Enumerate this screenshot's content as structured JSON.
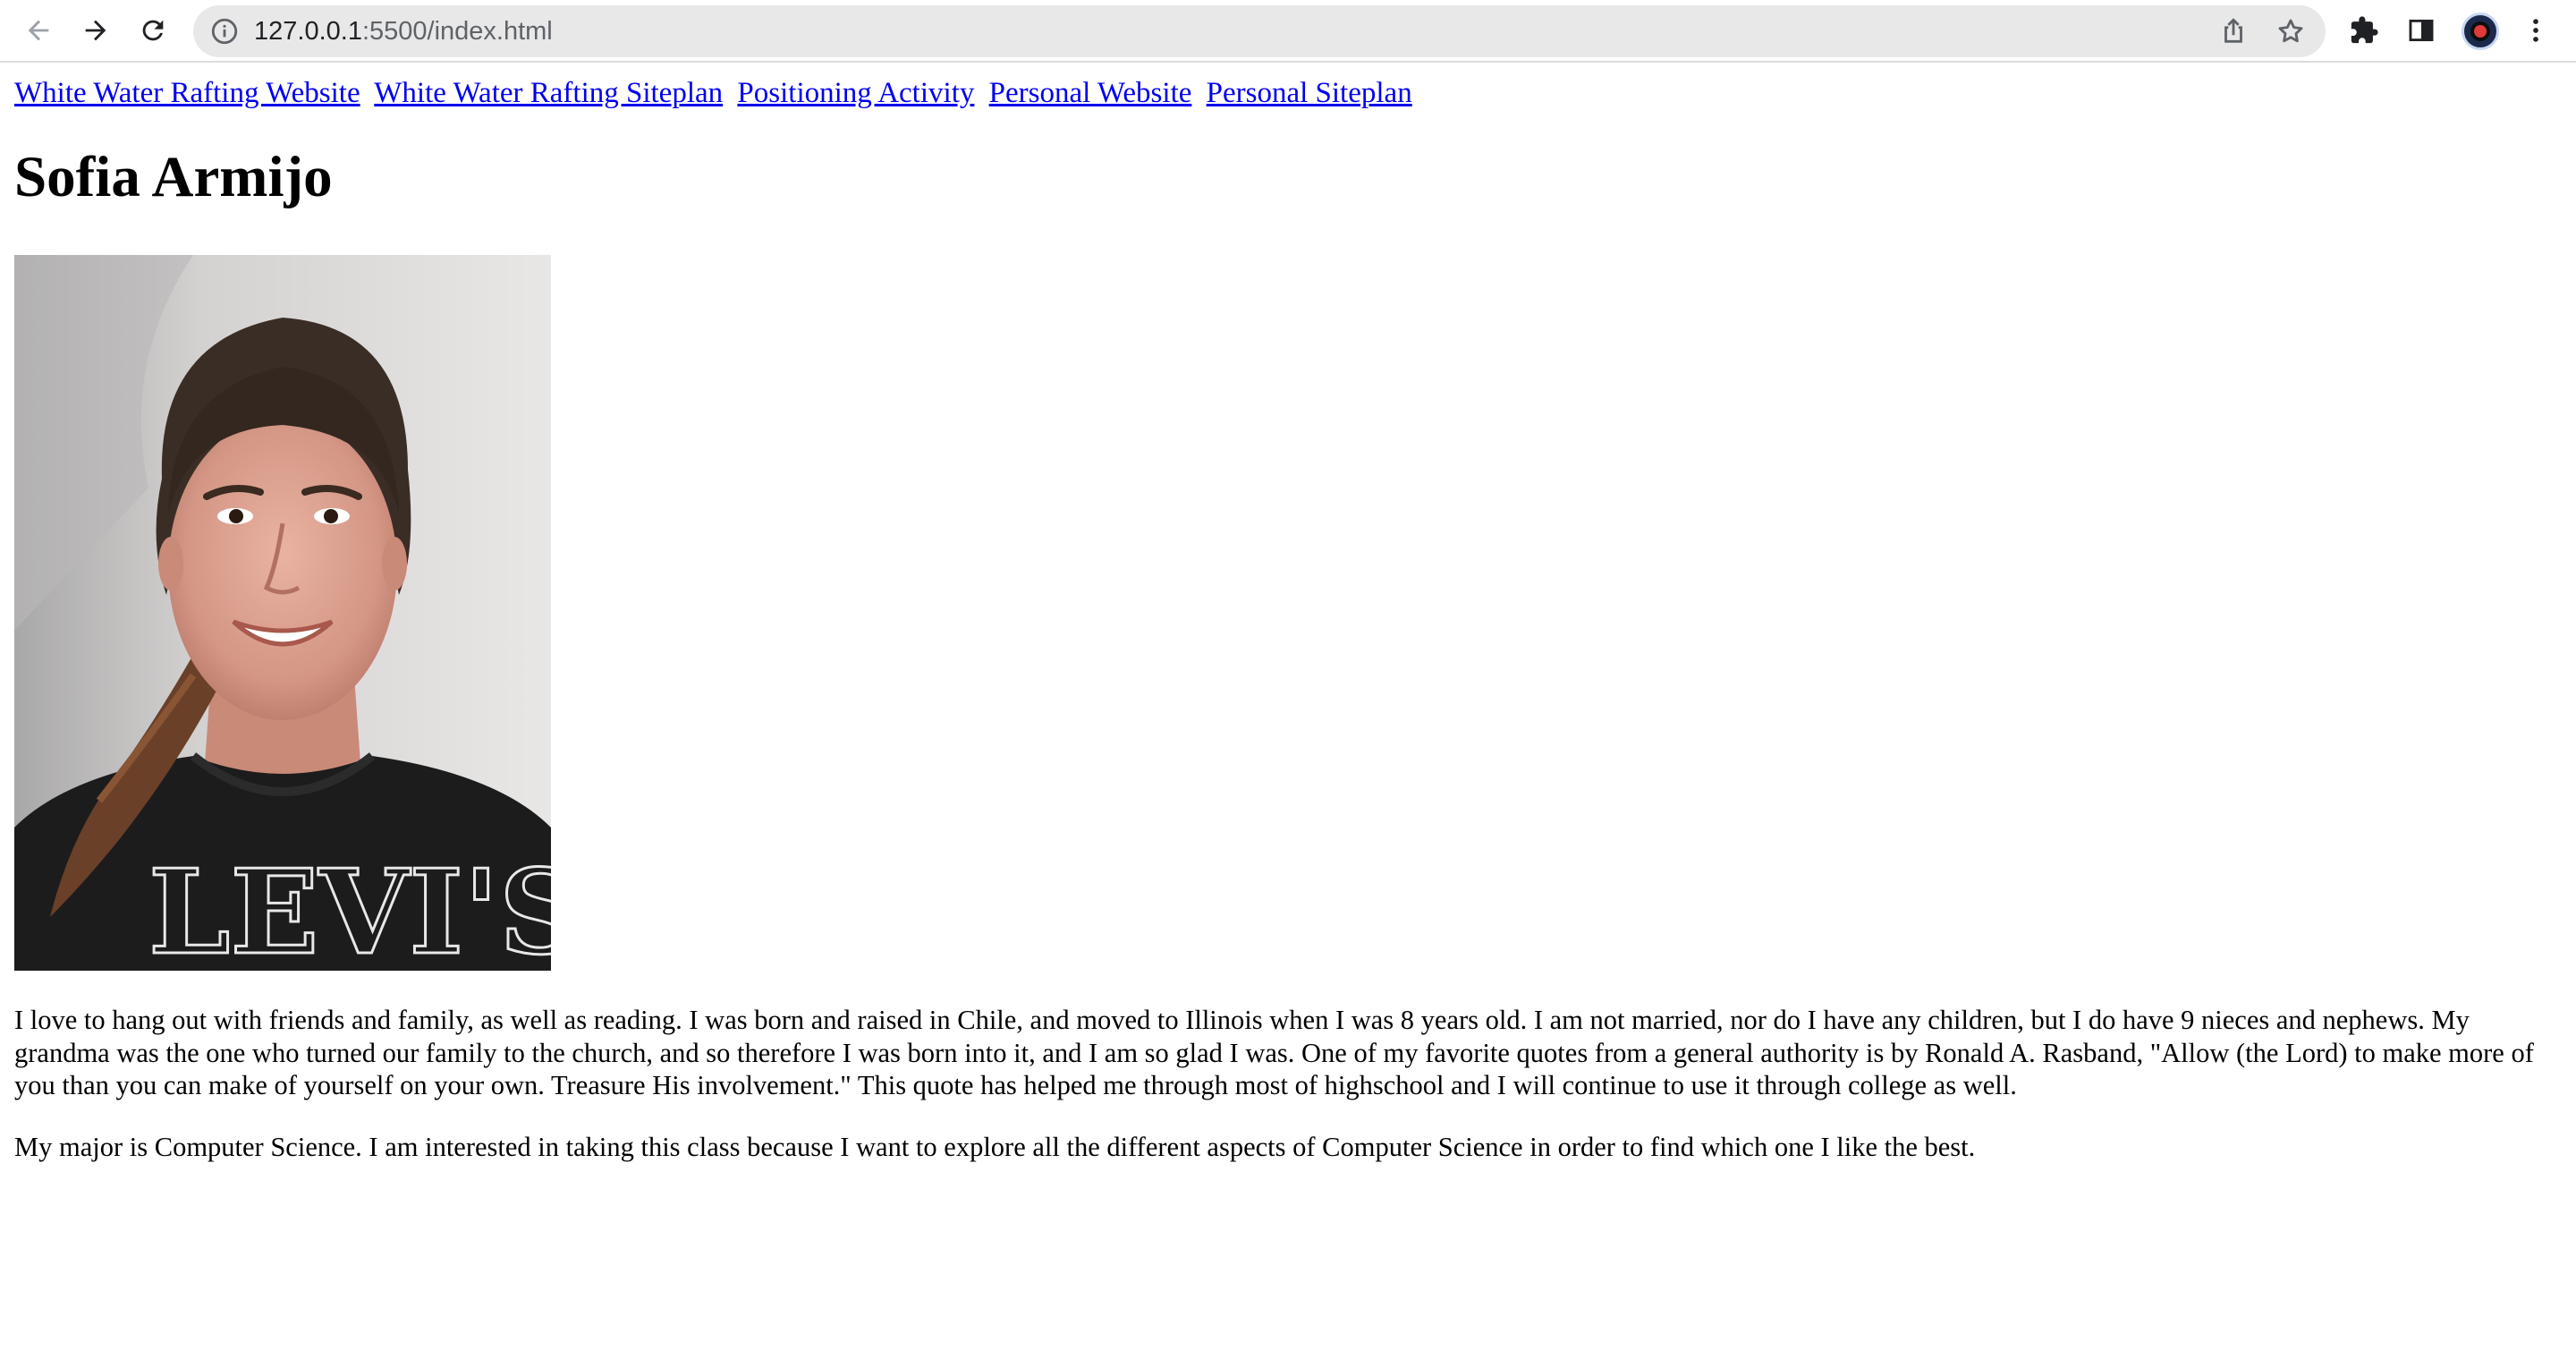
{
  "browser": {
    "url_host": "127.0.0.1",
    "url_rest": ":5500/index.html",
    "back_icon": "arrow-left-icon",
    "forward_icon": "arrow-right-icon",
    "reload_icon": "reload-icon"
  },
  "nav": {
    "links": [
      {
        "label": "White Water Rafting Website"
      },
      {
        "label": "White Water Rafting Siteplan"
      },
      {
        "label": "Positioning Activity"
      },
      {
        "label": "Personal Website"
      },
      {
        "label": "Personal Siteplan"
      }
    ]
  },
  "profile": {
    "name": "Sofia Armijo",
    "shirt_text": "LEVI'S",
    "paragraphs": [
      "I love to hang out with friends and family, as well as reading. I was born and raised in Chile, and moved to Illinois when I was 8 years old. I am not married, nor do I have any children, but I do have 9 nieces and nephews. My grandma was the one who turned our family to the church, and so therefore I was born into it, and I am so glad I was. One of my favorite quotes from a general authority is by Ronald A. Rasband, \"Allow (the Lord) to make more of you than you can make of yourself on your own. Treasure His involvement.\" This quote has helped me through most of highschool and I will continue to use it through college as well.",
      "My major is Computer Science. I am interested in taking this class because I want to explore all the different aspects of Computer Science in order to find which one I like the best."
    ]
  },
  "colors": {
    "link": "#0000ee",
    "omnibox_bg": "#e8e8e8",
    "toolbar_border": "#dadce0"
  }
}
